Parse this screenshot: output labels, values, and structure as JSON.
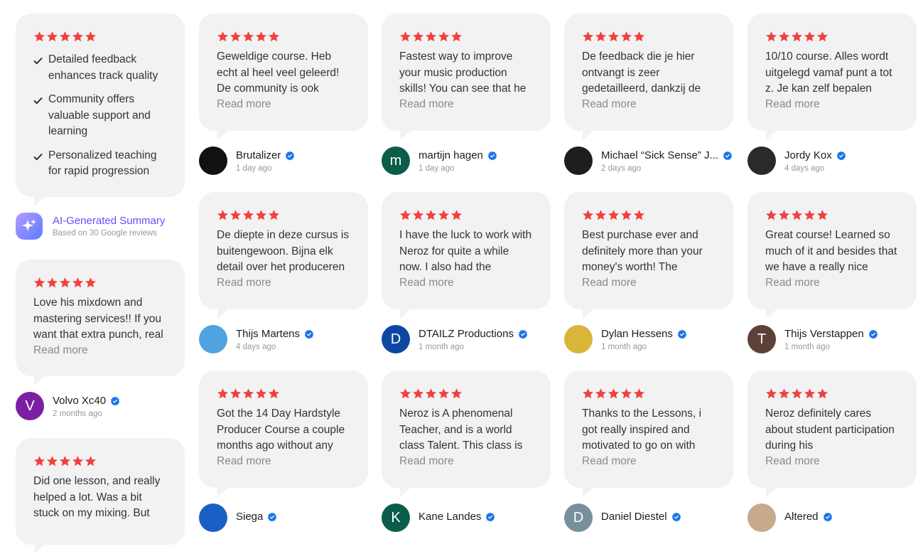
{
  "colors": {
    "star": "#f0413f",
    "verified": "#1a73e8",
    "accent": "#6b4cff"
  },
  "summary": {
    "points": [
      "Detailed feedback enhances track quality",
      "Community offers valuable support and learning",
      "Personalized teaching for rapid progression"
    ],
    "ai_title": "AI-Generated Summary",
    "ai_subtitle": "Based on 30 Google reviews"
  },
  "read_more_label": "Read more",
  "left_reviews": [
    {
      "text": "Love his mixdown and mastering services!! If you want that extra punch, real",
      "name": "Volvo Xc40",
      "time": "2 months ago",
      "initial": "V",
      "avatar_color": "#7b1fa2"
    },
    {
      "text": "Did one lesson, and really helped a lot. Was a bit stuck on my mixing. But",
      "name": "",
      "time": "",
      "initial": "",
      "avatar_color": ""
    }
  ],
  "reviews": [
    {
      "text": "Geweldige course. Heb echt al heel veel geleerd! De community is ook",
      "name": "Brutalizer",
      "time": "1 day ago",
      "initial": "",
      "avatar_color": "#111111",
      "avatar_icon": "dark-photo-avatar"
    },
    {
      "text": "Fastest way to improve your music production skills! You can see that he",
      "name": "martijn hagen",
      "time": "1 day ago",
      "initial": "m",
      "avatar_color": "#0b5d4a"
    },
    {
      "text": "De feedback die je hier ontvangt is zeer gedetailleerd, dankzij de",
      "name": "Michael “Sick Sense” J...",
      "time": "2 days ago",
      "initial": "",
      "avatar_color": "#1e1e1e",
      "avatar_icon": "sick-sense-logo-avatar"
    },
    {
      "text": "10/10 course. Alles wordt uitgelegd vamaf punt a tot z. Je kan zelf bepalen",
      "name": "Jordy Kox",
      "time": "4 days ago",
      "initial": "",
      "avatar_color": "#2a2a2a",
      "avatar_icon": "masked-photo-avatar"
    },
    {
      "text": "De diepte in deze cursus is buitengewoon. Bijna elk detail over het produceren",
      "name": "Thijs Martens",
      "time": "4 days ago",
      "initial": "",
      "avatar_color": "#4fa3e0",
      "avatar_icon": "boombox-avatar"
    },
    {
      "text": "I have the luck to work with Neroz for quite a while now. I also had the",
      "name": "DTAILZ Productions",
      "time": "1 month ago",
      "initial": "D",
      "avatar_color": "#0d47a1"
    },
    {
      "text": "Best purchase ever and definitely more than your money's worth! The",
      "name": "Dylan Hessens",
      "time": "1 month ago",
      "initial": "",
      "avatar_color": "#d9b63a",
      "avatar_icon": "yellow-photo-avatar"
    },
    {
      "text": "Great course! Learned so much of it and besides that we have a really nice",
      "name": "Thijs Verstappen",
      "time": "1 month ago",
      "initial": "T",
      "avatar_color": "#5d4037"
    },
    {
      "text": "Got the 14 Day Hardstyle Producer Course a couple months ago without any",
      "name": "Siega",
      "time": "",
      "initial": "",
      "avatar_color": "#1b5ec4",
      "avatar_icon": "sg-logo-avatar"
    },
    {
      "text": "Neroz is A phenomenal Teacher, and is a world class Talent. This class is",
      "name": "Kane Landes",
      "time": "",
      "initial": "K",
      "avatar_color": "#0b5d4a"
    },
    {
      "text": "Thanks to the Lessons, i got really inspired and motivated to go on with",
      "name": "Daniel Diestel",
      "time": "",
      "initial": "D",
      "avatar_color": "#78909c"
    },
    {
      "text": "Neroz definitely cares about student participation during his",
      "name": "Altered",
      "time": "",
      "initial": "",
      "avatar_color": "#c8a98a",
      "avatar_icon": "face-photo-avatar"
    }
  ]
}
